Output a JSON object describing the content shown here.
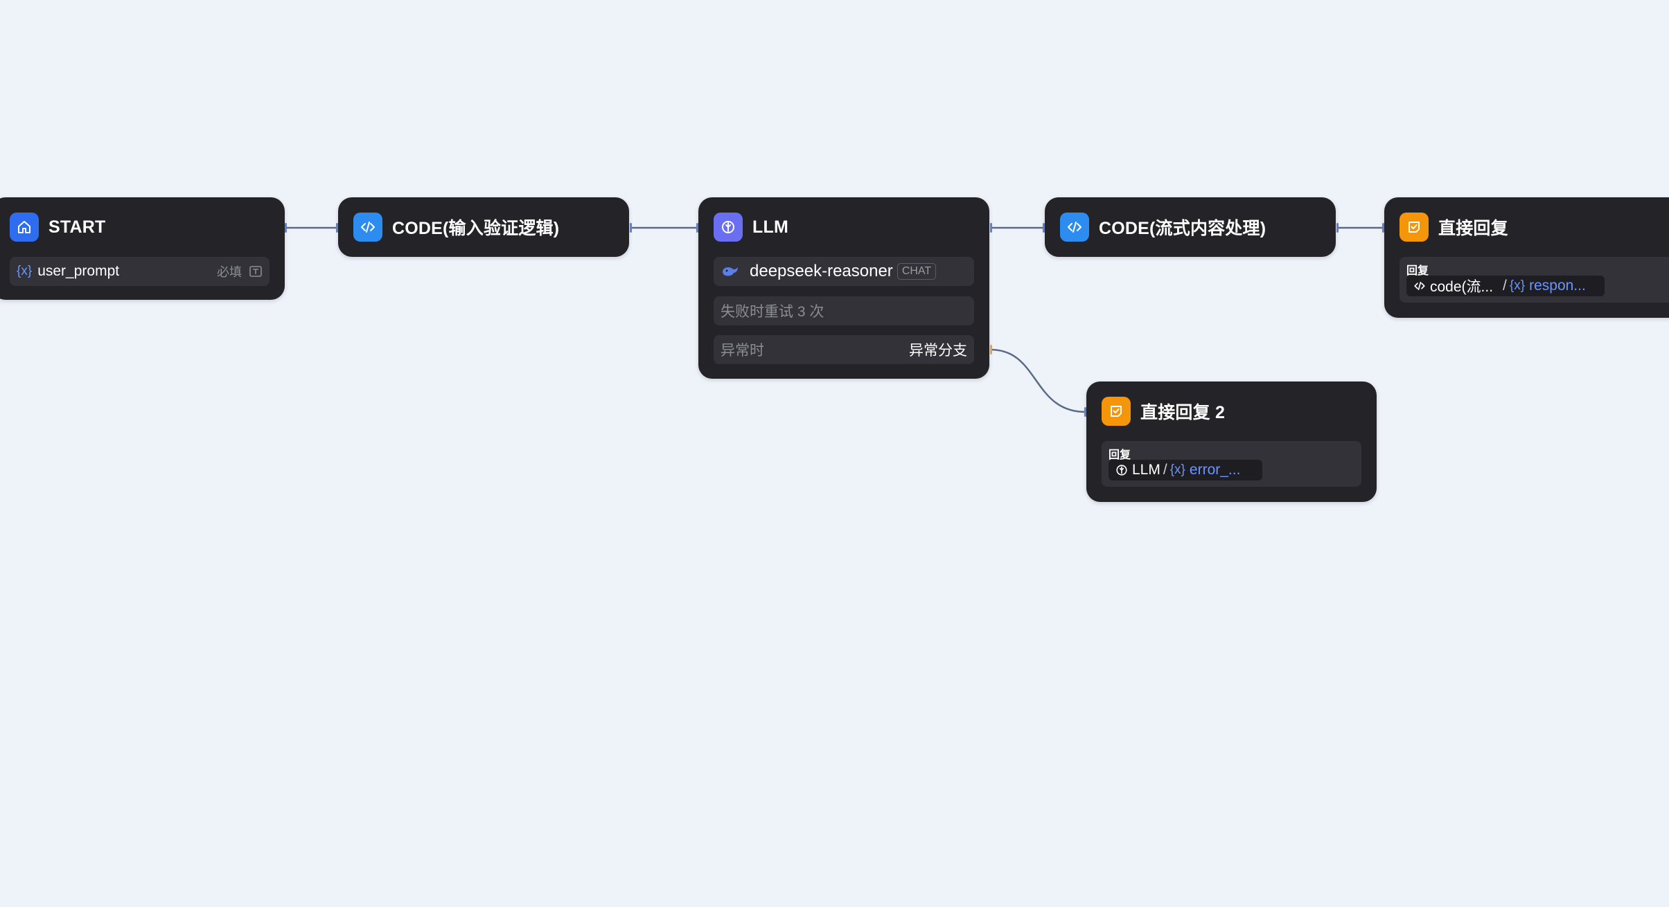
{
  "canvas": {
    "background": "#eef2f9"
  },
  "colors": {
    "node_bg": "#232328",
    "edge": "#5c6a85",
    "start_icon": "#2f6df0",
    "code_icon": "#2d8cf0",
    "llm_icon": "#6a6ef0",
    "reply_icon": "#f5960a",
    "variable": "#6d95ff"
  },
  "nodes": {
    "start": {
      "title": "START",
      "icon": "home-icon",
      "variable": {
        "glyph": "{x}",
        "name": "user_prompt",
        "required": "必填",
        "type_icon": "text-input-icon"
      }
    },
    "code_validate": {
      "title": "CODE(输入验证逻辑)",
      "icon": "code-icon"
    },
    "llm": {
      "title": "LLM",
      "icon": "llm-icon",
      "model": {
        "name": "deepseek-reasoner",
        "badge": "CHAT",
        "icon": "deepseek-whale-icon"
      },
      "retry": "失败时重试 3 次",
      "error_label": "异常时",
      "error_value": "异常分支"
    },
    "code_stream": {
      "title": "CODE(流式内容处理)",
      "icon": "code-icon"
    },
    "reply1": {
      "title": "直接回复",
      "icon": "reply-check-icon",
      "label": "回复",
      "chip": {
        "source": "code(流...",
        "sep": "/",
        "glyph": "{x}",
        "var": "respon..."
      }
    },
    "reply2": {
      "title": "直接回复 2",
      "icon": "reply-check-icon",
      "label": "回复",
      "chip": {
        "source": "LLM",
        "sep": "/",
        "glyph": "{x}",
        "var": "error_..."
      }
    }
  }
}
